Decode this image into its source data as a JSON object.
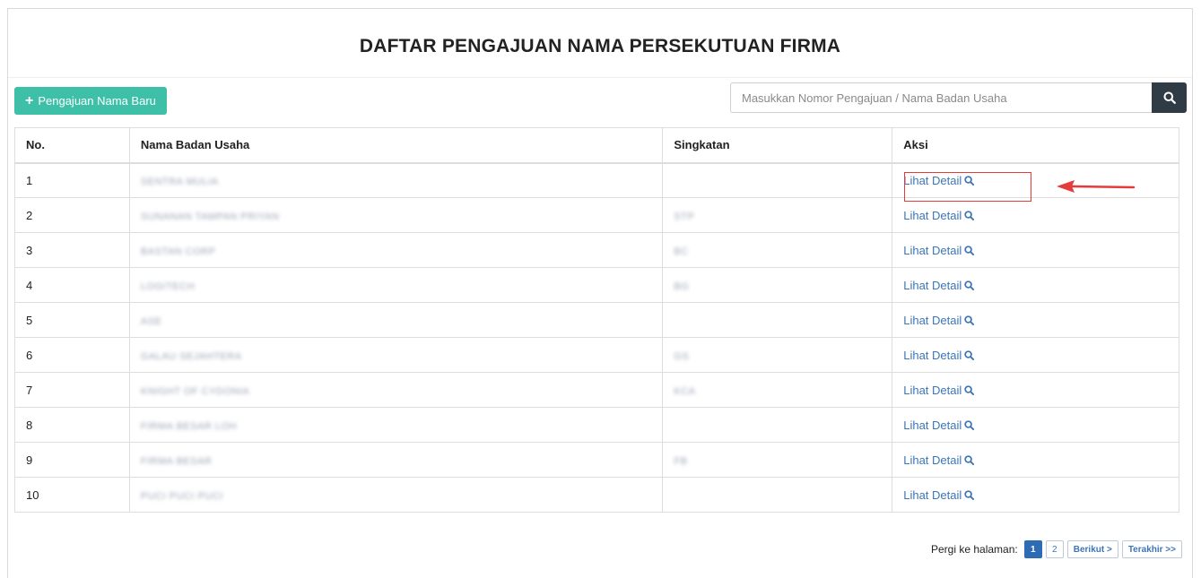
{
  "page": {
    "title": "DAFTAR PENGAJUAN NAMA PERSEKUTUAN FIRMA"
  },
  "toolbar": {
    "new_button_label": "Pengajuan Nama Baru",
    "new_button_icon": "plus-icon",
    "search_placeholder": "Masukkan Nomor Pengajuan / Nama Badan Usaha",
    "search_icon": "search-icon"
  },
  "table": {
    "headers": {
      "no": "No.",
      "name": "Nama Badan Usaha",
      "abbr": "Singkatan",
      "action": "Aksi"
    },
    "rows": [
      {
        "no": "1",
        "name": "SENTRA MULIA",
        "abbr": "",
        "action": "Lihat Detail"
      },
      {
        "no": "2",
        "name": "SUNANAN TAMPAN PRIYAN",
        "abbr": "STP",
        "action": "Lihat Detail"
      },
      {
        "no": "3",
        "name": "BASTAN CORP",
        "abbr": "BC",
        "action": "Lihat Detail"
      },
      {
        "no": "4",
        "name": "LOGITECH",
        "abbr": "BG",
        "action": "Lihat Detail"
      },
      {
        "no": "5",
        "name": "ASE",
        "abbr": "",
        "action": "Lihat Detail"
      },
      {
        "no": "6",
        "name": "GALAU SEJAHTERA",
        "abbr": "GS",
        "action": "Lihat Detail"
      },
      {
        "no": "7",
        "name": "KNIGHT OF CYDONIA",
        "abbr": "KCA",
        "action": "Lihat Detail"
      },
      {
        "no": "8",
        "name": "FIRMA BESAR LOH",
        "abbr": "",
        "action": "Lihat Detail"
      },
      {
        "no": "9",
        "name": "FIRMA BESAR",
        "abbr": "FB",
        "action": "Lihat Detail"
      },
      {
        "no": "10",
        "name": "PUCI PUCI PUCI",
        "abbr": "",
        "action": "Lihat Detail"
      }
    ]
  },
  "pagination": {
    "label": "Pergi ke halaman:",
    "pages": [
      "1",
      "2"
    ],
    "current": "1",
    "next": "Berikut >",
    "last": "Terakhir >>"
  },
  "colors": {
    "accent": "#3dbfa8",
    "search_button": "#2f3b45",
    "link": "#3c75b6",
    "highlight": "#e53b3b"
  }
}
